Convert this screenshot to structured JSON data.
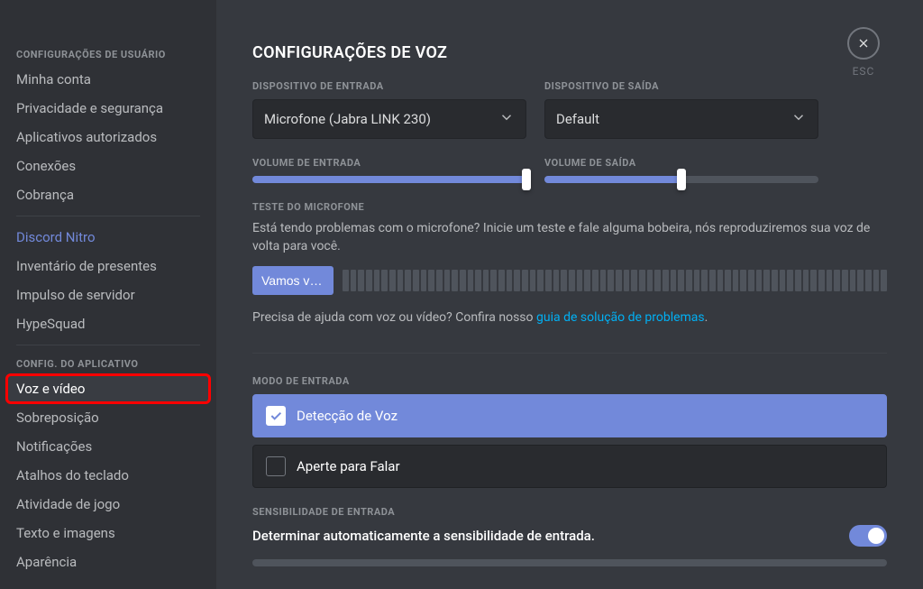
{
  "sidebar": {
    "heading_user": "CONFIGURAÇÕES DE USUÁRIO",
    "heading_app": "CONFIG. DO APLICATIVO",
    "user_items": [
      "Minha conta",
      "Privacidade e segurança",
      "Aplicativos autorizados",
      "Conexões",
      "Cobrança"
    ],
    "nitro_items": [
      "Discord Nitro",
      "Inventário de presentes",
      "Impulso de servidor",
      "HypeSquad"
    ],
    "app_items": [
      "Voz e vídeo",
      "Sobreposição",
      "Notificações",
      "Atalhos do teclado",
      "Atividade de jogo",
      "Texto e imagens",
      "Aparência"
    ]
  },
  "esc": "ESC",
  "content": {
    "title": "CONFIGURAÇÕES DE VOZ",
    "input_device_label": "DISPOSITIVO DE ENTRADA",
    "input_device_value": "Microfone (Jabra LINK 230)",
    "output_device_label": "DISPOSITIVO DE SAÍDA",
    "output_device_value": "Default",
    "input_volume_label": "VOLUME DE ENTRADA",
    "output_volume_label": "VOLUME DE SAÍDA",
    "input_volume_pct": 100,
    "output_volume_pct": 50,
    "mic_test_label": "TESTE DO MICROFONE",
    "mic_test_help": "Está tendo problemas com o microfone? Inicie um teste e fale alguma bobeira, nós reproduziremos sua voz de volta para você.",
    "mic_test_button": "Vamos verif…",
    "help_link_pre": "Precisa de ajuda com voz ou vídeo? Confira nosso ",
    "help_link": "guia de solução de problemas",
    "help_link_post": ".",
    "input_mode_label": "MODO DE ENTRADA",
    "mode_voice": "Detecção de Voz",
    "mode_ptt": "Aperte para Falar",
    "sensitivity_label": "SENSIBILIDADE DE ENTRADA",
    "auto_sensitivity": "Determinar automaticamente a sensibilidade de entrada.",
    "auto_sensitivity_on": true
  }
}
